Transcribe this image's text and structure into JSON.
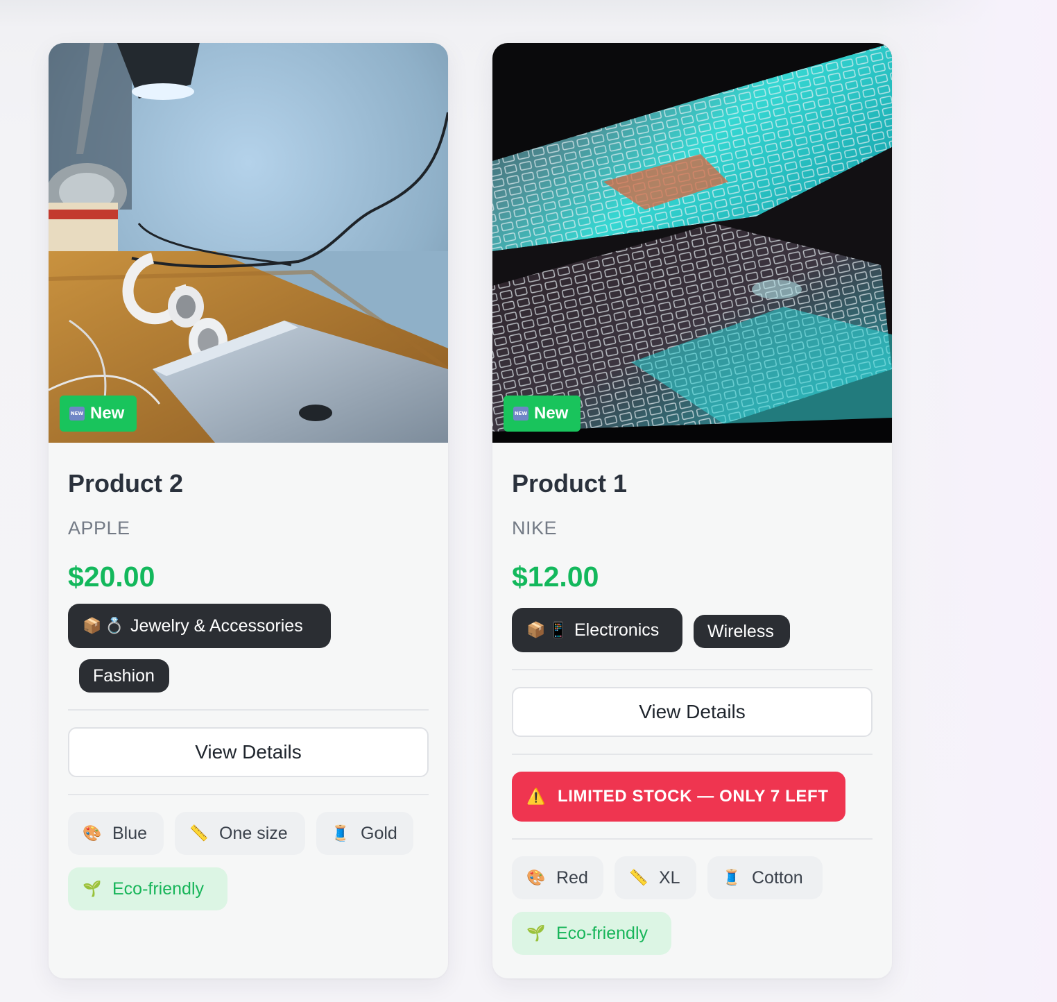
{
  "products": [
    {
      "badge": "New",
      "badge_icon": "new-button-icon",
      "title": "Product 2",
      "brand": "APPLE",
      "price": "$20.00",
      "category": "Jewelry & Accessories",
      "category_icons": [
        "package-icon",
        "ring-icon"
      ],
      "tags": [
        "Fashion"
      ],
      "view_details": "View Details",
      "attributes": [
        {
          "icon": "palette-icon",
          "label": "Blue"
        },
        {
          "icon": "ruler-icon",
          "label": "One size"
        },
        {
          "icon": "thread-spool-icon",
          "label": "Gold"
        }
      ],
      "eco_label": "Eco-friendly",
      "eco_icon": "seedling-icon"
    },
    {
      "badge": "New",
      "badge_icon": "new-button-icon",
      "title": "Product 1",
      "brand": "NIKE",
      "price": "$12.00",
      "category": "Electronics",
      "category_icons": [
        "package-icon",
        "mobile-phone-icon"
      ],
      "tags": [
        "Wireless"
      ],
      "view_details": "View Details",
      "stock_warning": "LIMITED STOCK — ONLY 7 LEFT",
      "stock_icon": "warning-icon",
      "attributes": [
        {
          "icon": "palette-icon",
          "label": "Red"
        },
        {
          "icon": "ruler-icon",
          "label": "XL"
        },
        {
          "icon": "thread-spool-icon",
          "label": "Cotton"
        }
      ],
      "eco_label": "Eco-friendly",
      "eco_icon": "seedling-icon"
    }
  ],
  "colors": {
    "price_green": "#13b85c",
    "badge_green": "#19c45c",
    "tag_dark": "#2b2e33",
    "stock_red": "#ef3550",
    "eco_bg": "#dcf5e4"
  }
}
